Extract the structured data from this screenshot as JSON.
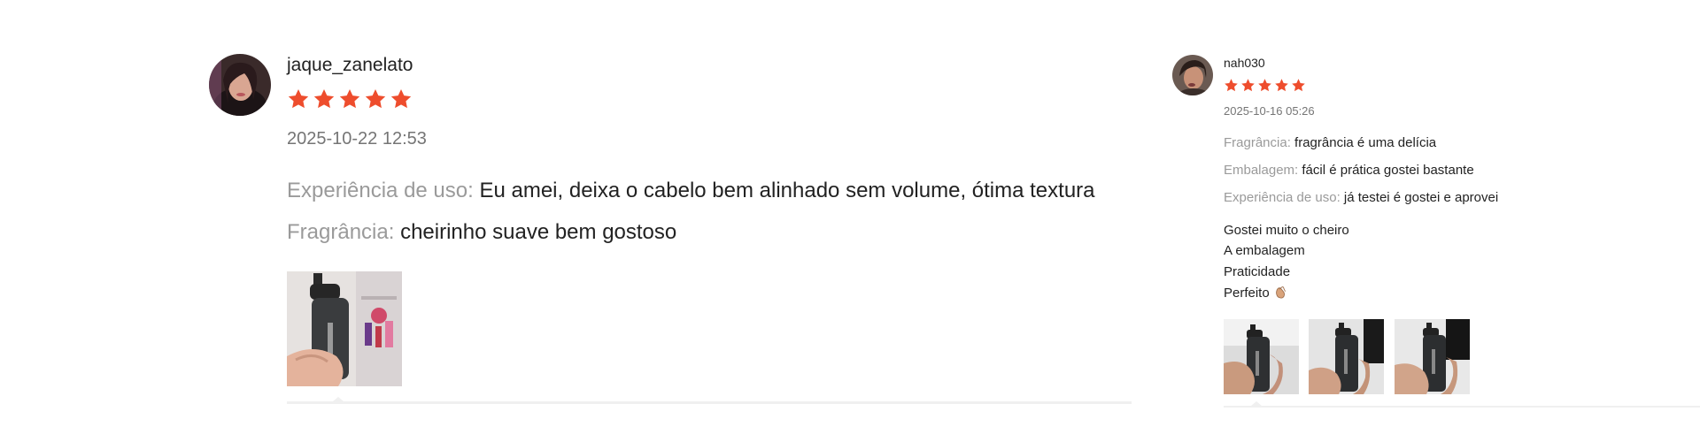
{
  "reviews": [
    {
      "username": "jaque_zanelato",
      "rating": 5,
      "date": "2025-10-22 12:53",
      "attributes": [
        {
          "label": "Experiência de uso:",
          "value": "Eu amei, deixa o cabelo bem alinhado sem volume, ótima textura"
        },
        {
          "label": "Fragrância:",
          "value": "cheirinho suave bem gostoso"
        }
      ],
      "photo_count": 1
    },
    {
      "username": "nah030",
      "rating": 5,
      "date": "2025-10-16 05:26",
      "attributes": [
        {
          "label": "Fragrância:",
          "value": "fragrância é uma delícia"
        },
        {
          "label": "Embalagem:",
          "value": "fácil é prática gostei bastante"
        },
        {
          "label": "Experiência de uso:",
          "value": "já testei é gostei e aprovei"
        }
      ],
      "comment_lines": [
        "Gostei muito o cheiro",
        "A embalagem",
        "Praticidade",
        "Perfeito"
      ],
      "comment_emoji": "clapping-hands-icon",
      "photo_count": 3
    }
  ],
  "colors": {
    "star": "#ee4d2d",
    "label_gray": "#9a9a9a",
    "date_gray": "#757575",
    "separator": "#f0f0f0"
  }
}
